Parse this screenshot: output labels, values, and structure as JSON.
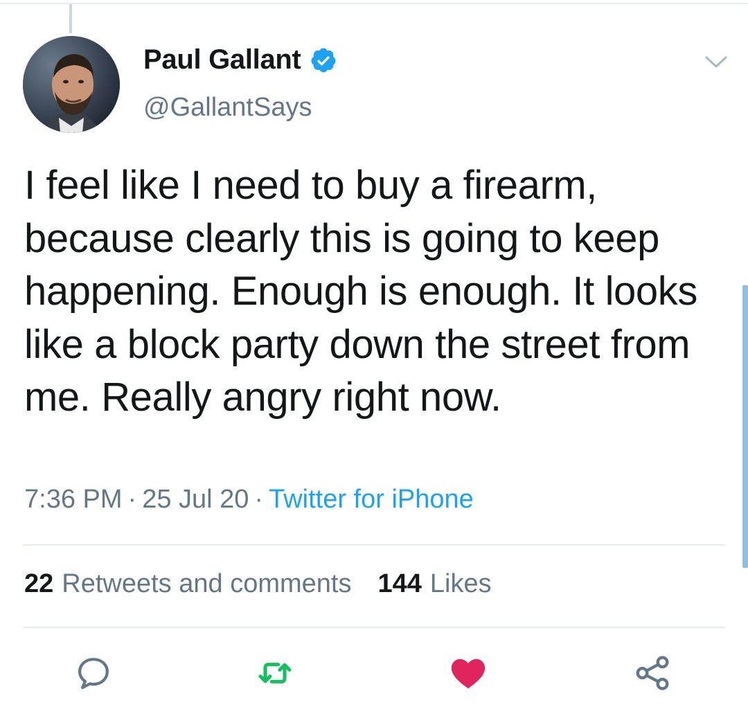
{
  "author": {
    "name": "Paul Gallant",
    "handle": "@GallantSays",
    "verified": true
  },
  "tweet": {
    "text": "I feel like I need to buy a firearm, because clearly this is going to keep happening. Enough is enough. It looks like a block party down the street from me. Really angry right now.",
    "time": "7:36 PM",
    "date": "25 Jul 20",
    "separator": "·",
    "source": "Twitter for iPhone"
  },
  "stats": {
    "retweets_count": "22",
    "retweets_label": "Retweets and comments",
    "likes_count": "144",
    "likes_label": "Likes"
  },
  "actions": {
    "reply_icon": "reply-icon",
    "retweet_icon": "retweet-icon",
    "like_icon": "heart-icon",
    "share_icon": "share-icon"
  },
  "colors": {
    "accent": "#1da1f2",
    "retweet": "#17bf63",
    "like": "#e0245e",
    "muted": "#657786",
    "text": "#14171a"
  }
}
